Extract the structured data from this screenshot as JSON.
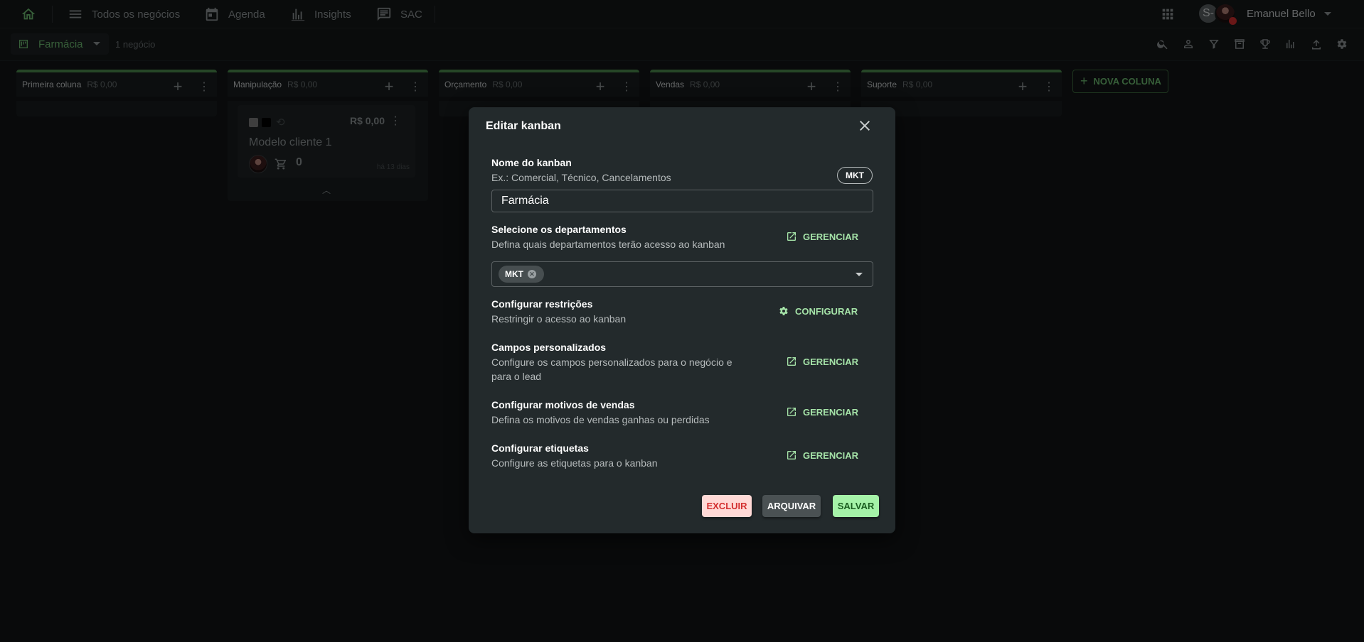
{
  "nav": {
    "items": [
      {
        "label": "Todos os negócios"
      },
      {
        "label": "Agenda"
      },
      {
        "label": "Insights"
      },
      {
        "label": "SAC"
      }
    ],
    "avatar_initial": "S-",
    "user_name": "Emanuel Bello"
  },
  "toolbar": {
    "kanban_name": "Farmácia",
    "deal_count": "1 negócio"
  },
  "columns": [
    {
      "name": "Primeira coluna",
      "amount": "R$ 0,00"
    },
    {
      "name": "Manipulação",
      "amount": "R$ 0,00"
    },
    {
      "name": "Orçamento",
      "amount": "R$ 0,00"
    },
    {
      "name": "Vendas",
      "amount": "R$ 0,00"
    },
    {
      "name": "Suporte",
      "amount": "R$ 0,00"
    }
  ],
  "card": {
    "amount": "R$ 0,00",
    "title": "Modelo cliente 1",
    "quantity": "0",
    "age": "há 13 dias"
  },
  "new_column_label": "NOVA COLUNA",
  "modal": {
    "title": "Editar kanban",
    "name_section": {
      "title": "Nome do kanban",
      "hint": "Ex.: Comercial, Técnico, Cancelamentos",
      "chip": "MKT",
      "value": "Farmácia"
    },
    "departments": {
      "title": "Selecione os departamentos",
      "desc": "Defina quais departamentos terão acesso ao kanban",
      "action": "GERENCIAR",
      "selected_chip": "MKT"
    },
    "restrictions": {
      "title": "Configurar restrições",
      "desc": "Restringir o acesso ao kanban",
      "action": "CONFIGURAR"
    },
    "custom_fields": {
      "title": "Campos personalizados",
      "desc_line1": "Configure os campos personalizados para o negócio e",
      "desc_line2": "para o lead",
      "action": "GERENCIAR"
    },
    "sales_reasons": {
      "title": "Configurar motivos de vendas",
      "desc": "Defina os motivos de vendas ganhas ou perdidas",
      "action": "GERENCIAR"
    },
    "tags": {
      "title": "Configurar etiquetas",
      "desc": "Configure as etiquetas para o kanban",
      "action": "GERENCIAR"
    },
    "buttons": {
      "delete": "EXCLUIR",
      "archive": "ARQUIVAR",
      "save": "SALVAR"
    }
  }
}
